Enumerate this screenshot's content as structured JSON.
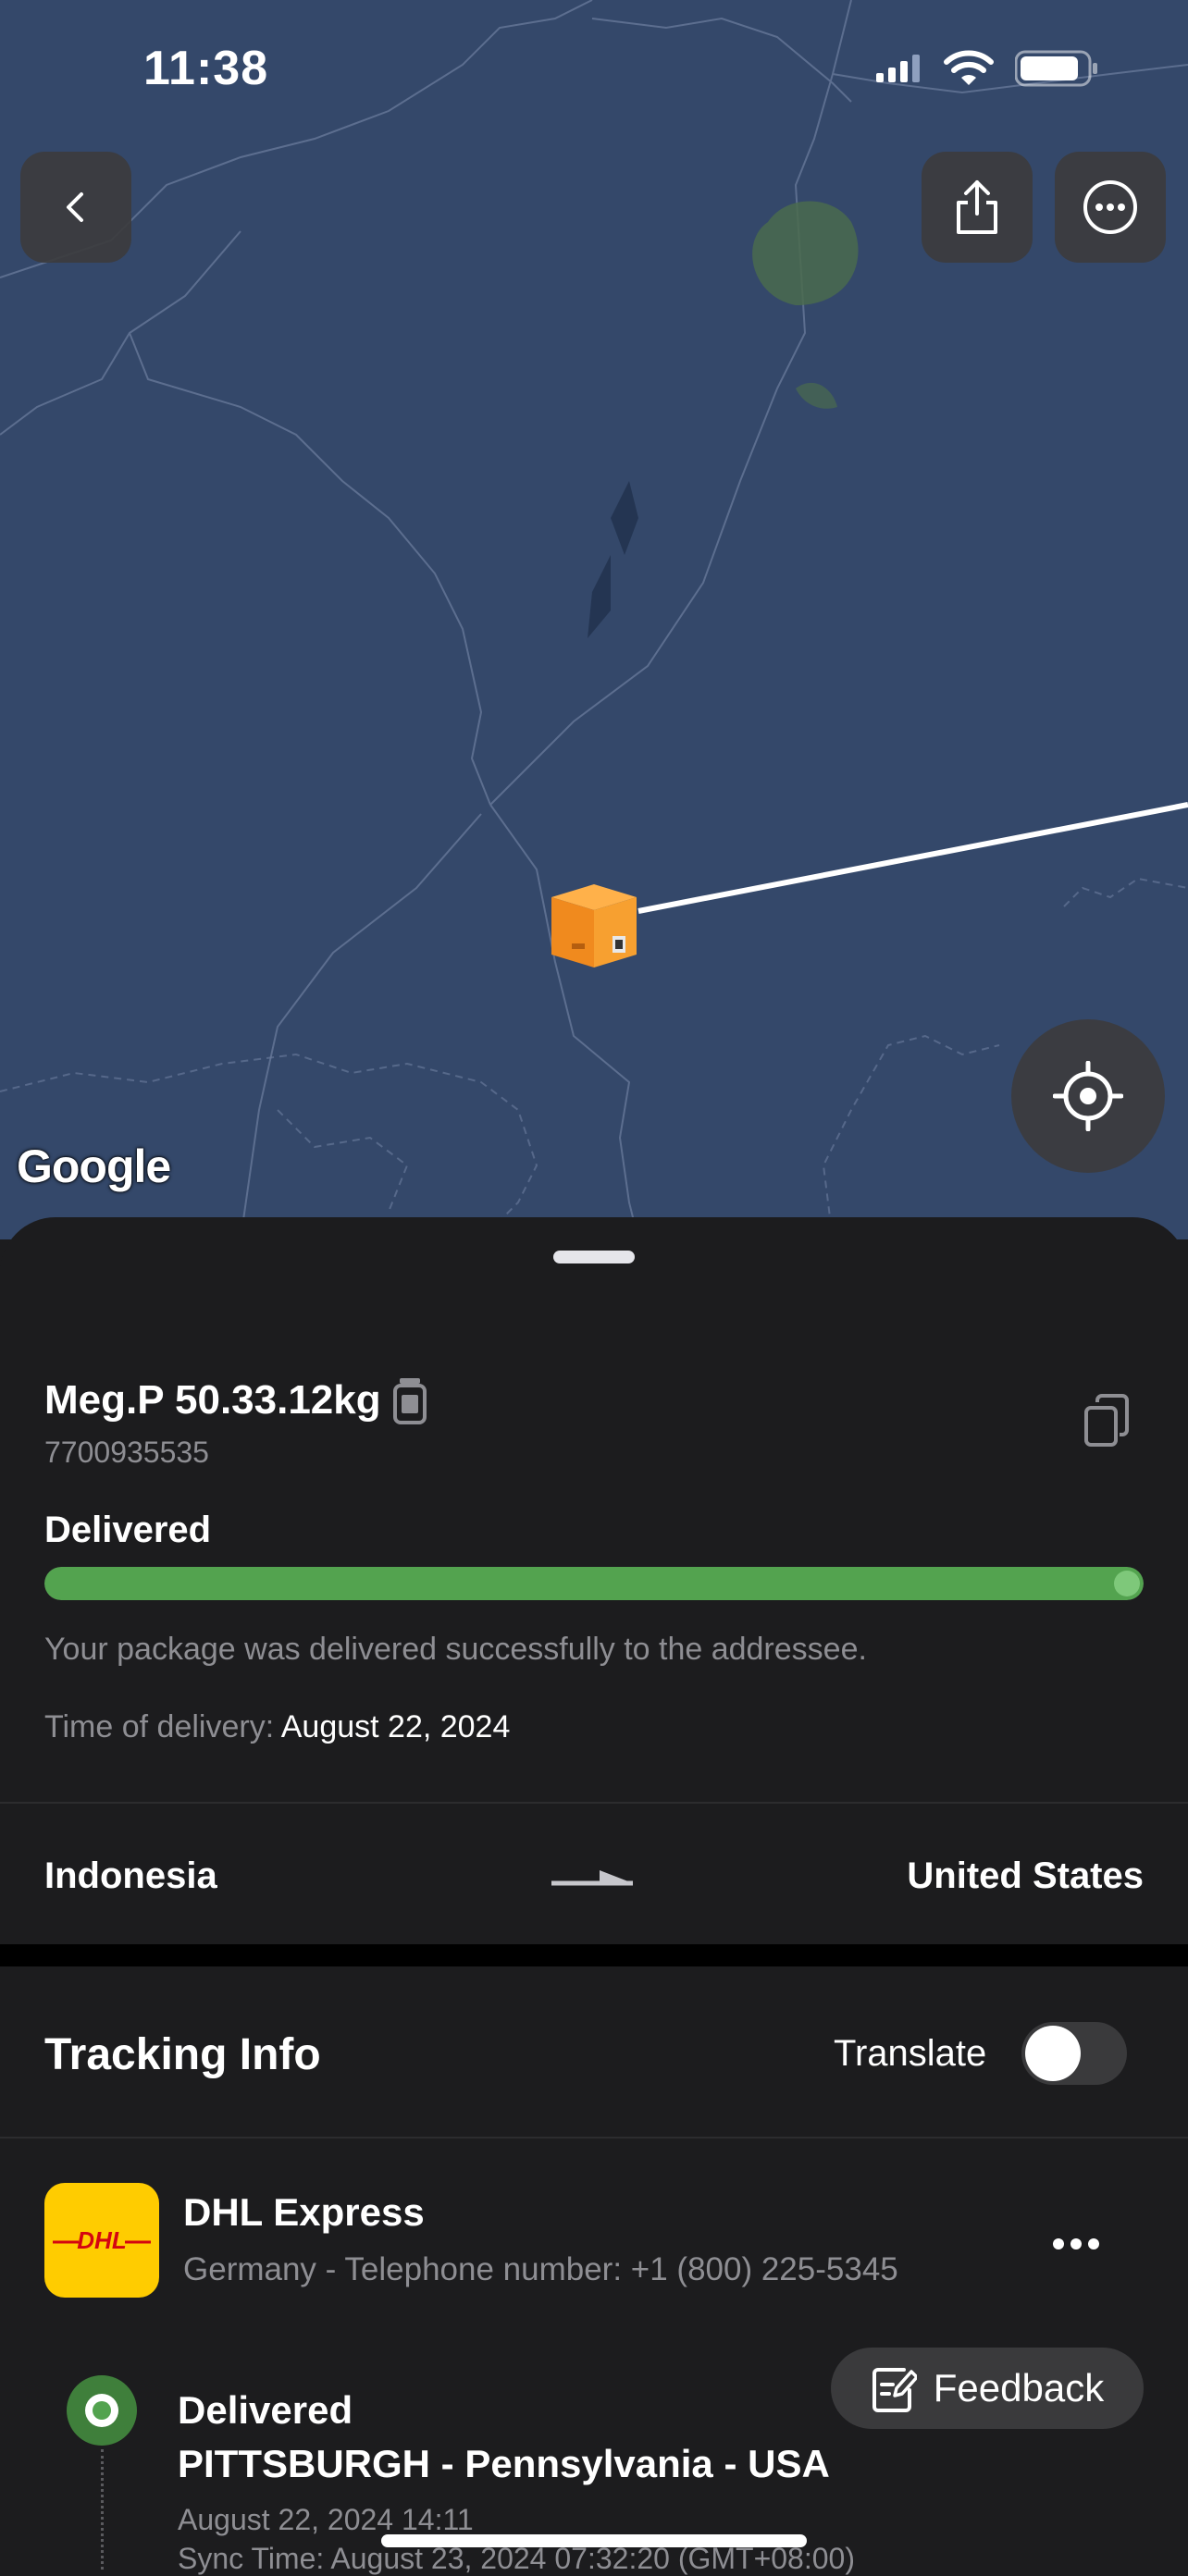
{
  "status_bar": {
    "time": "11:38"
  },
  "map": {
    "attribution": "Google"
  },
  "package": {
    "name": "Meg.P 50.33.12kg",
    "tracking_number": "7700935535",
    "status": "Delivered",
    "progress": 1.0,
    "description": "Your package was delivered successfully to the addressee.",
    "delivery_time_label": "Time of delivery:",
    "delivery_time_value": "August 22, 2024"
  },
  "route": {
    "from": "Indonesia",
    "to": "United States"
  },
  "tracking": {
    "title": "Tracking Info",
    "translate_label": "Translate",
    "translate_enabled": false
  },
  "carrier": {
    "name": "DHL Express",
    "contact": "Germany - Telephone number: +1 (800) 225-5345",
    "logo_text": "DHL",
    "logo_color": "#ffcc00",
    "logo_text_color": "#d40511"
  },
  "feedback": {
    "label": "Feedback"
  },
  "events": [
    {
      "status": "Delivered",
      "location": "PITTSBURGH - Pennsylvania - USA",
      "time": "August 22, 2024 14:11",
      "sync": "Sync Time: August 23, 2024 07:32:20 (GMT+08:00)"
    }
  ],
  "colors": {
    "accent_green": "#53a34f",
    "map_bg": "#34486a",
    "sheet_bg": "#1c1c1e"
  }
}
